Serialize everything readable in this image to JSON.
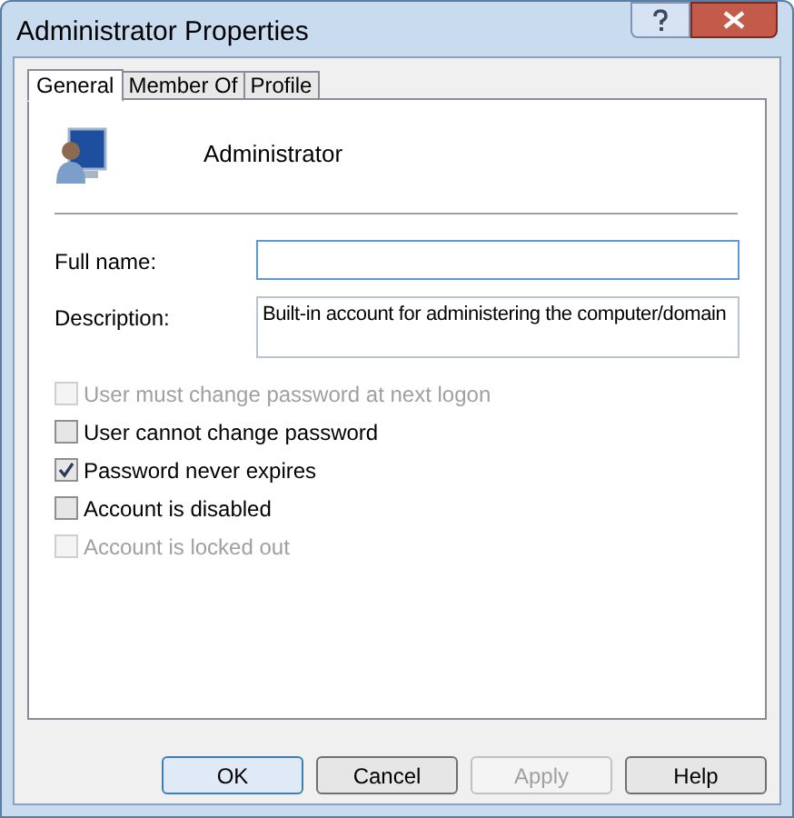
{
  "window": {
    "title": "Administrator Properties"
  },
  "tabs": [
    {
      "label": "General",
      "selected": true
    },
    {
      "label": "Member Of",
      "selected": false
    },
    {
      "label": "Profile",
      "selected": false
    }
  ],
  "account": {
    "name": "Administrator"
  },
  "fields": [
    {
      "label": "Full name:",
      "focused": true,
      "multiline": false
    },
    {
      "label": "Description:",
      "value": "Built-in account for administering the computer/domain",
      "focused": false,
      "multiline": true
    }
  ],
  "options": [
    {
      "label": "User must change password at next logon",
      "checked": false,
      "disabled": true
    },
    {
      "label": "User cannot change password",
      "checked": false,
      "disabled": false
    },
    {
      "label": "Password never expires",
      "checked": true,
      "disabled": false
    },
    {
      "label": "Account is disabled",
      "checked": false,
      "disabled": false
    },
    {
      "label": "Account is locked out",
      "checked": false,
      "disabled": true
    }
  ],
  "buttons": [
    {
      "label": "OK",
      "default": true,
      "disabled": false
    },
    {
      "label": "Cancel",
      "default": false,
      "disabled": false
    },
    {
      "label": "Apply",
      "default": false,
      "disabled": true
    },
    {
      "label": "Help",
      "default": false,
      "disabled": false
    }
  ]
}
